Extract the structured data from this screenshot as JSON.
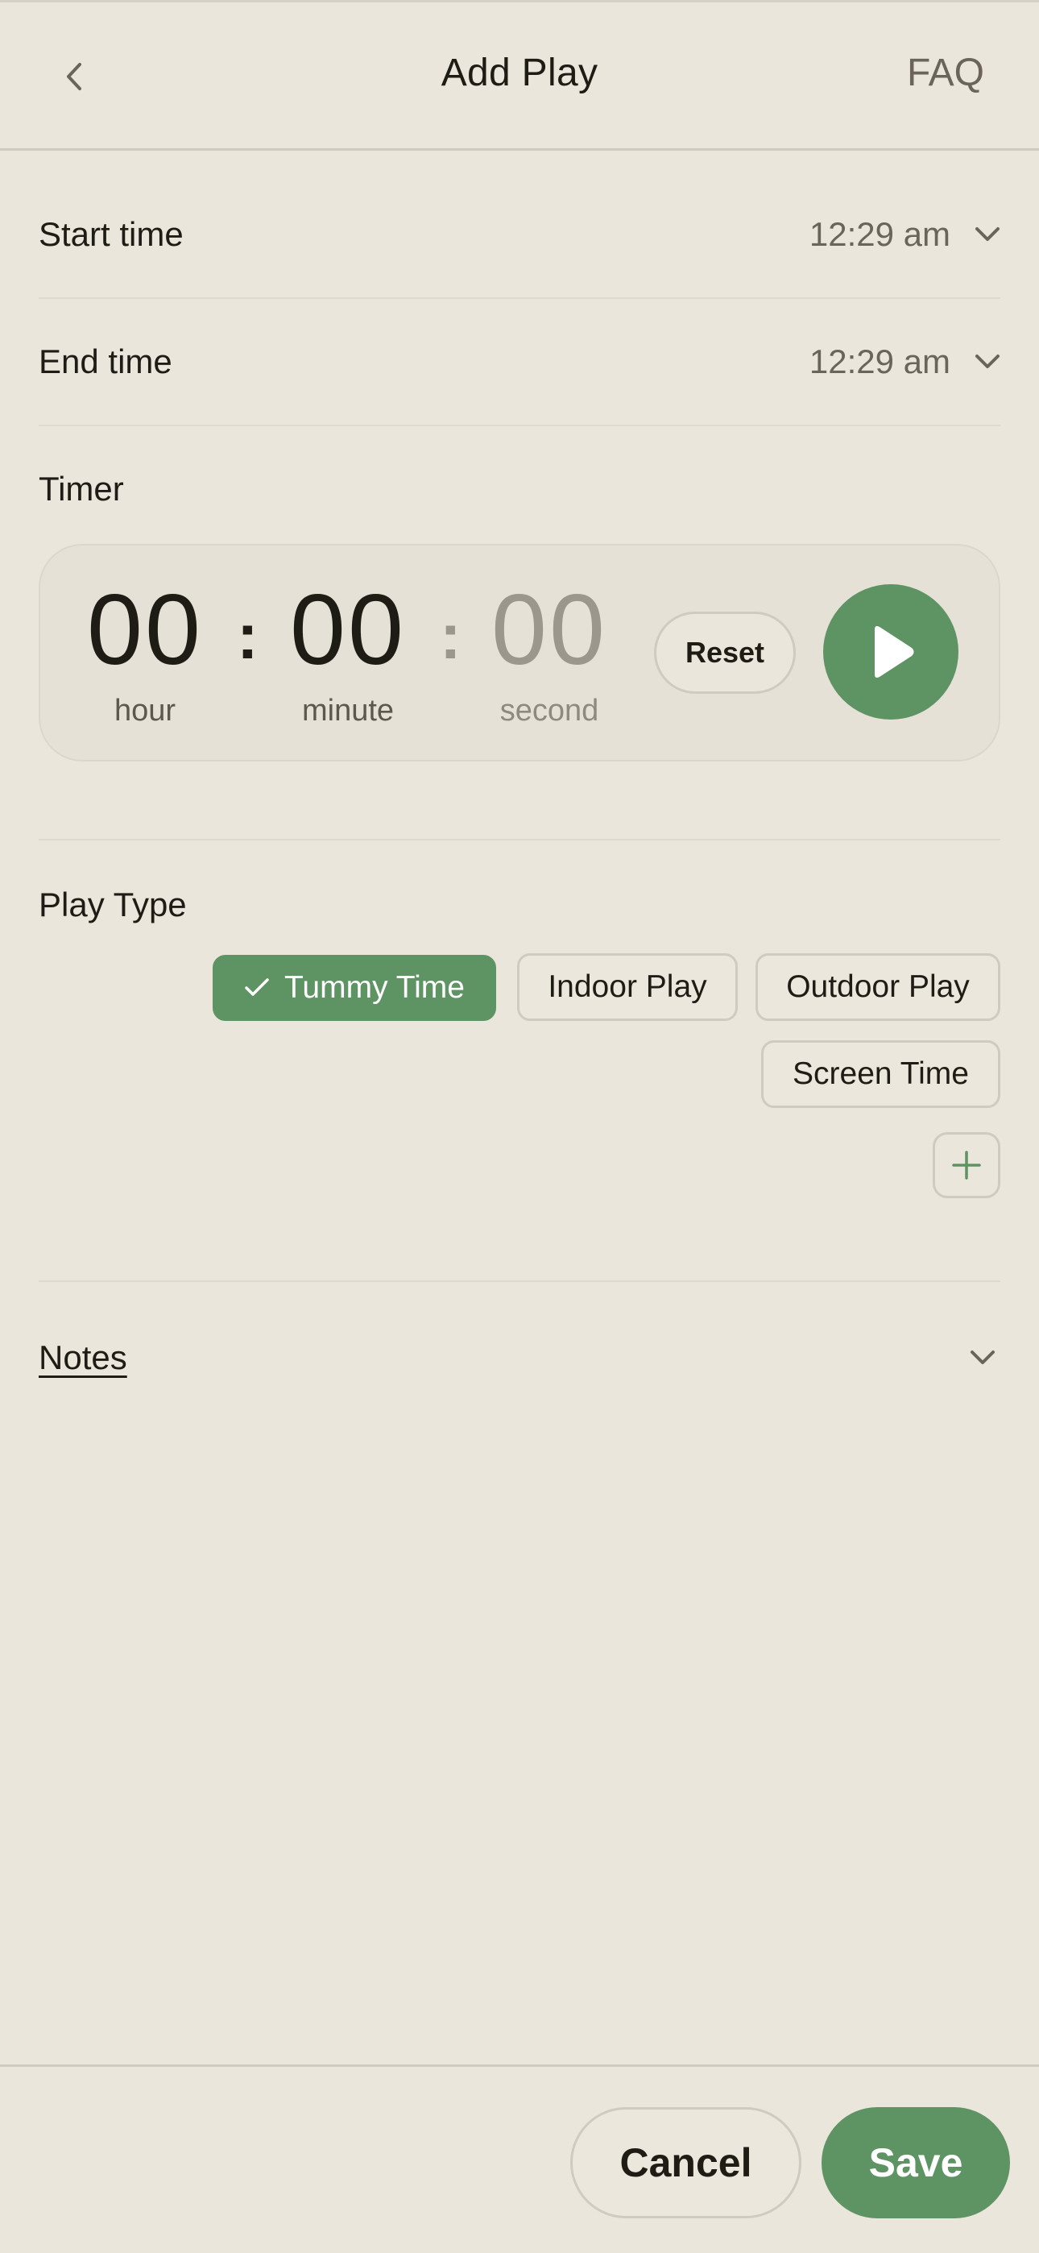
{
  "header": {
    "title": "Add Play",
    "faq_label": "FAQ"
  },
  "start_time": {
    "label": "Start time",
    "value": "12:29 am"
  },
  "end_time": {
    "label": "End time",
    "value": "12:29 am"
  },
  "timer": {
    "label": "Timer",
    "hour": "00",
    "minute": "00",
    "second": "00",
    "hour_caption": "hour",
    "minute_caption": "minute",
    "second_caption": "second",
    "separator": ":",
    "reset_label": "Reset"
  },
  "play_type": {
    "label": "Play Type",
    "options": [
      {
        "label": "Tummy Time",
        "selected": true
      },
      {
        "label": "Indoor Play",
        "selected": false
      },
      {
        "label": "Outdoor Play",
        "selected": false
      },
      {
        "label": "Screen Time",
        "selected": false
      }
    ]
  },
  "notes": {
    "label": "Notes"
  },
  "footer": {
    "cancel_label": "Cancel",
    "save_label": "Save"
  },
  "colors": {
    "background": "#eae6db",
    "accent": "#5e9463",
    "text": "#1f1c16",
    "muted_text": "#6a645a",
    "border": "#cfcbc1"
  }
}
